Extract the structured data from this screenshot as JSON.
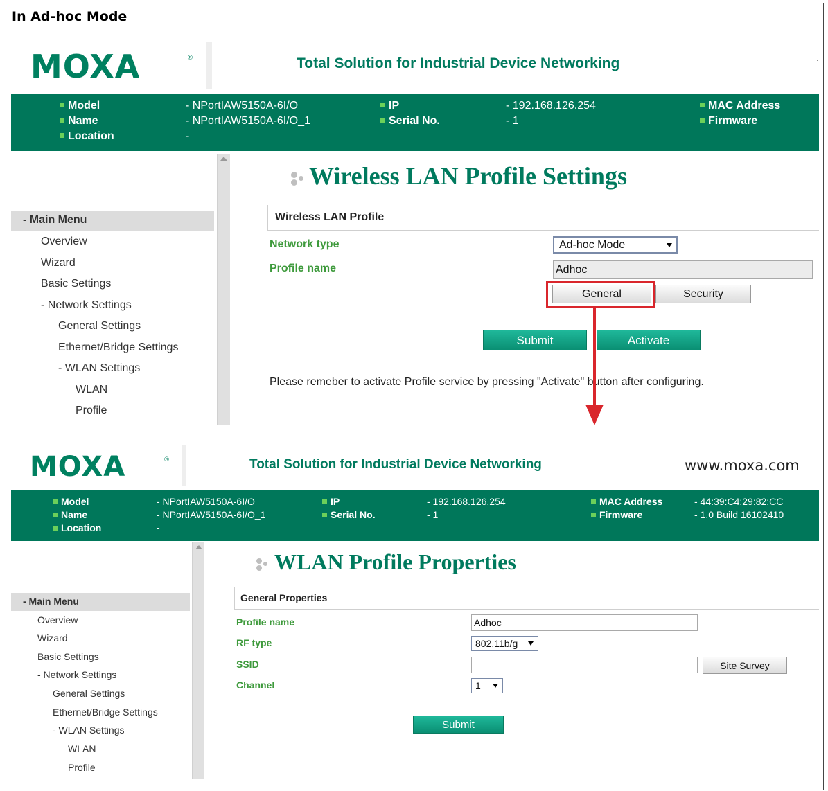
{
  "doc_title": "In Ad-hoc Mode",
  "panel1": {
    "logo": "MOXA",
    "logo_reg": "®",
    "tagline": "Total Solution for Industrial Device Networking",
    "website_fragment": "·",
    "info": {
      "model_label": "Model",
      "model_value": "- NPortIAW5150A-6I/O",
      "name_label": "Name",
      "name_value": "- NPortIAW5150A-6I/O_1",
      "location_label": "Location",
      "location_value": "-",
      "ip_label": "IP",
      "ip_value": "- 192.168.126.254",
      "serial_label": "Serial No.",
      "serial_value": "- 1",
      "mac_label": "MAC Address",
      "firmware_label": "Firmware"
    },
    "menu": {
      "head": "- Main Menu",
      "items": [
        "Overview",
        "Wizard",
        "Basic Settings",
        "- Network Settings",
        "General Settings",
        "Ethernet/Bridge Settings",
        "- WLAN Settings",
        "WLAN",
        "Profile"
      ]
    },
    "heading": "Wireless LAN Profile Settings",
    "section": "Wireless LAN Profile",
    "network_type_label": "Network type",
    "network_type_value": "Ad-hoc Mode",
    "profile_name_label": "Profile name",
    "profile_name_value": "Adhoc",
    "tab_general": "General",
    "tab_security": "Security",
    "submit": "Submit",
    "activate": "Activate",
    "note": "Please remeber to activate Profile service by pressing \"Activate\" button after configuring."
  },
  "panel2": {
    "logo": "MOXA",
    "logo_reg": "®",
    "tagline": "Total Solution for Industrial Device Networking",
    "website": "www.moxa.com",
    "info": {
      "model_label": "Model",
      "model_value": "- NPortIAW5150A-6I/O",
      "name_label": "Name",
      "name_value": "- NPortIAW5150A-6I/O_1",
      "location_label": "Location",
      "location_value": "-",
      "ip_label": "IP",
      "ip_value": "- 192.168.126.254",
      "serial_label": "Serial No.",
      "serial_value": "- 1",
      "mac_label": "MAC Address",
      "mac_value": "- 44:39:C4:29:82:CC",
      "firmware_label": "Firmware",
      "firmware_value": "- 1.0 Build 16102410"
    },
    "menu": {
      "head": "- Main Menu",
      "items": [
        "Overview",
        "Wizard",
        "Basic Settings",
        "- Network Settings",
        "General Settings",
        "Ethernet/Bridge Settings",
        "- WLAN Settings",
        "WLAN",
        "Profile"
      ]
    },
    "heading": "WLAN Profile Properties",
    "section": "General Properties",
    "profile_name_label": "Profile name",
    "profile_name_value": "Adhoc",
    "rf_type_label": "RF type",
    "rf_type_value": "802.11b/g",
    "ssid_label": "SSID",
    "ssid_value": "",
    "site_survey": "Site Survey",
    "channel_label": "Channel",
    "channel_value": "1",
    "submit": "Submit"
  },
  "colors": {
    "brand_green": "#00775a",
    "label_green": "#3e9a3c",
    "annotation_red": "#d9262c"
  }
}
